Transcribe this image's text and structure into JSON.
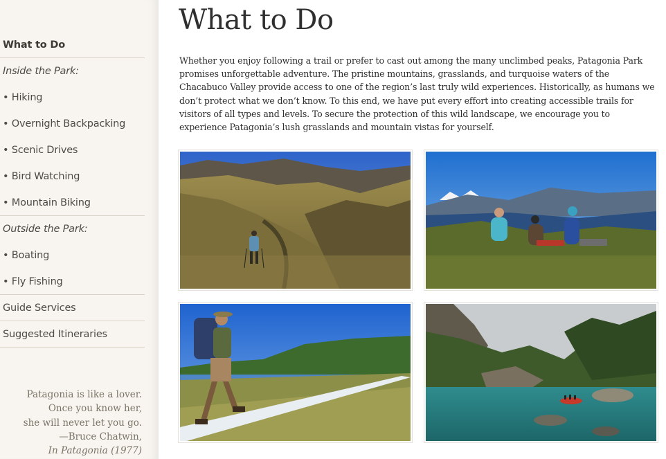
{
  "sidebar": {
    "items": [
      {
        "label": "What to Do"
      },
      {
        "label": "Inside the Park:"
      },
      {
        "label": "• Hiking"
      },
      {
        "label": "• Overnight Backpacking"
      },
      {
        "label": "• Scenic Drives"
      },
      {
        "label": "• Bird Watching"
      },
      {
        "label": "• Mountain Biking"
      },
      {
        "label": "Outside the Park:"
      },
      {
        "label": "• Boating"
      },
      {
        "label": "• Fly Fishing"
      },
      {
        "label": "Guide Services"
      },
      {
        "label": "Suggested Itineraries"
      }
    ],
    "quote": {
      "line1": "Patagonia is like a lover.",
      "line2": "Once you know her,",
      "line3": "she will never let you go.",
      "author": "—Bruce Chatwin,",
      "source": "In Patagonia (1977)"
    }
  },
  "main": {
    "title": "What to Do",
    "intro": "Whether you enjoy following a trail or prefer to cast out among the many unclimbed peaks, Patagonia Park promises unforgettable adventure. The pristine mountains, grasslands, and turquoise waters of the Chacabuco Valley provide access to one of the region’s last truly wild experiences. Historically, as humans we don’t protect what we don’t know. To this end, we have put every effort into creating accessible trails for visitors of all types and levels. To secure the protection of this wild landscape, we encourage you to experience Patagonia’s lush grasslands and mountain vistas for yourself."
  },
  "colors": {
    "sidebar_bg": "#f8f5f0",
    "sidebar_text": "#4e4a44",
    "body_text": "#2f2f2f",
    "quote_text": "#7a7467"
  }
}
